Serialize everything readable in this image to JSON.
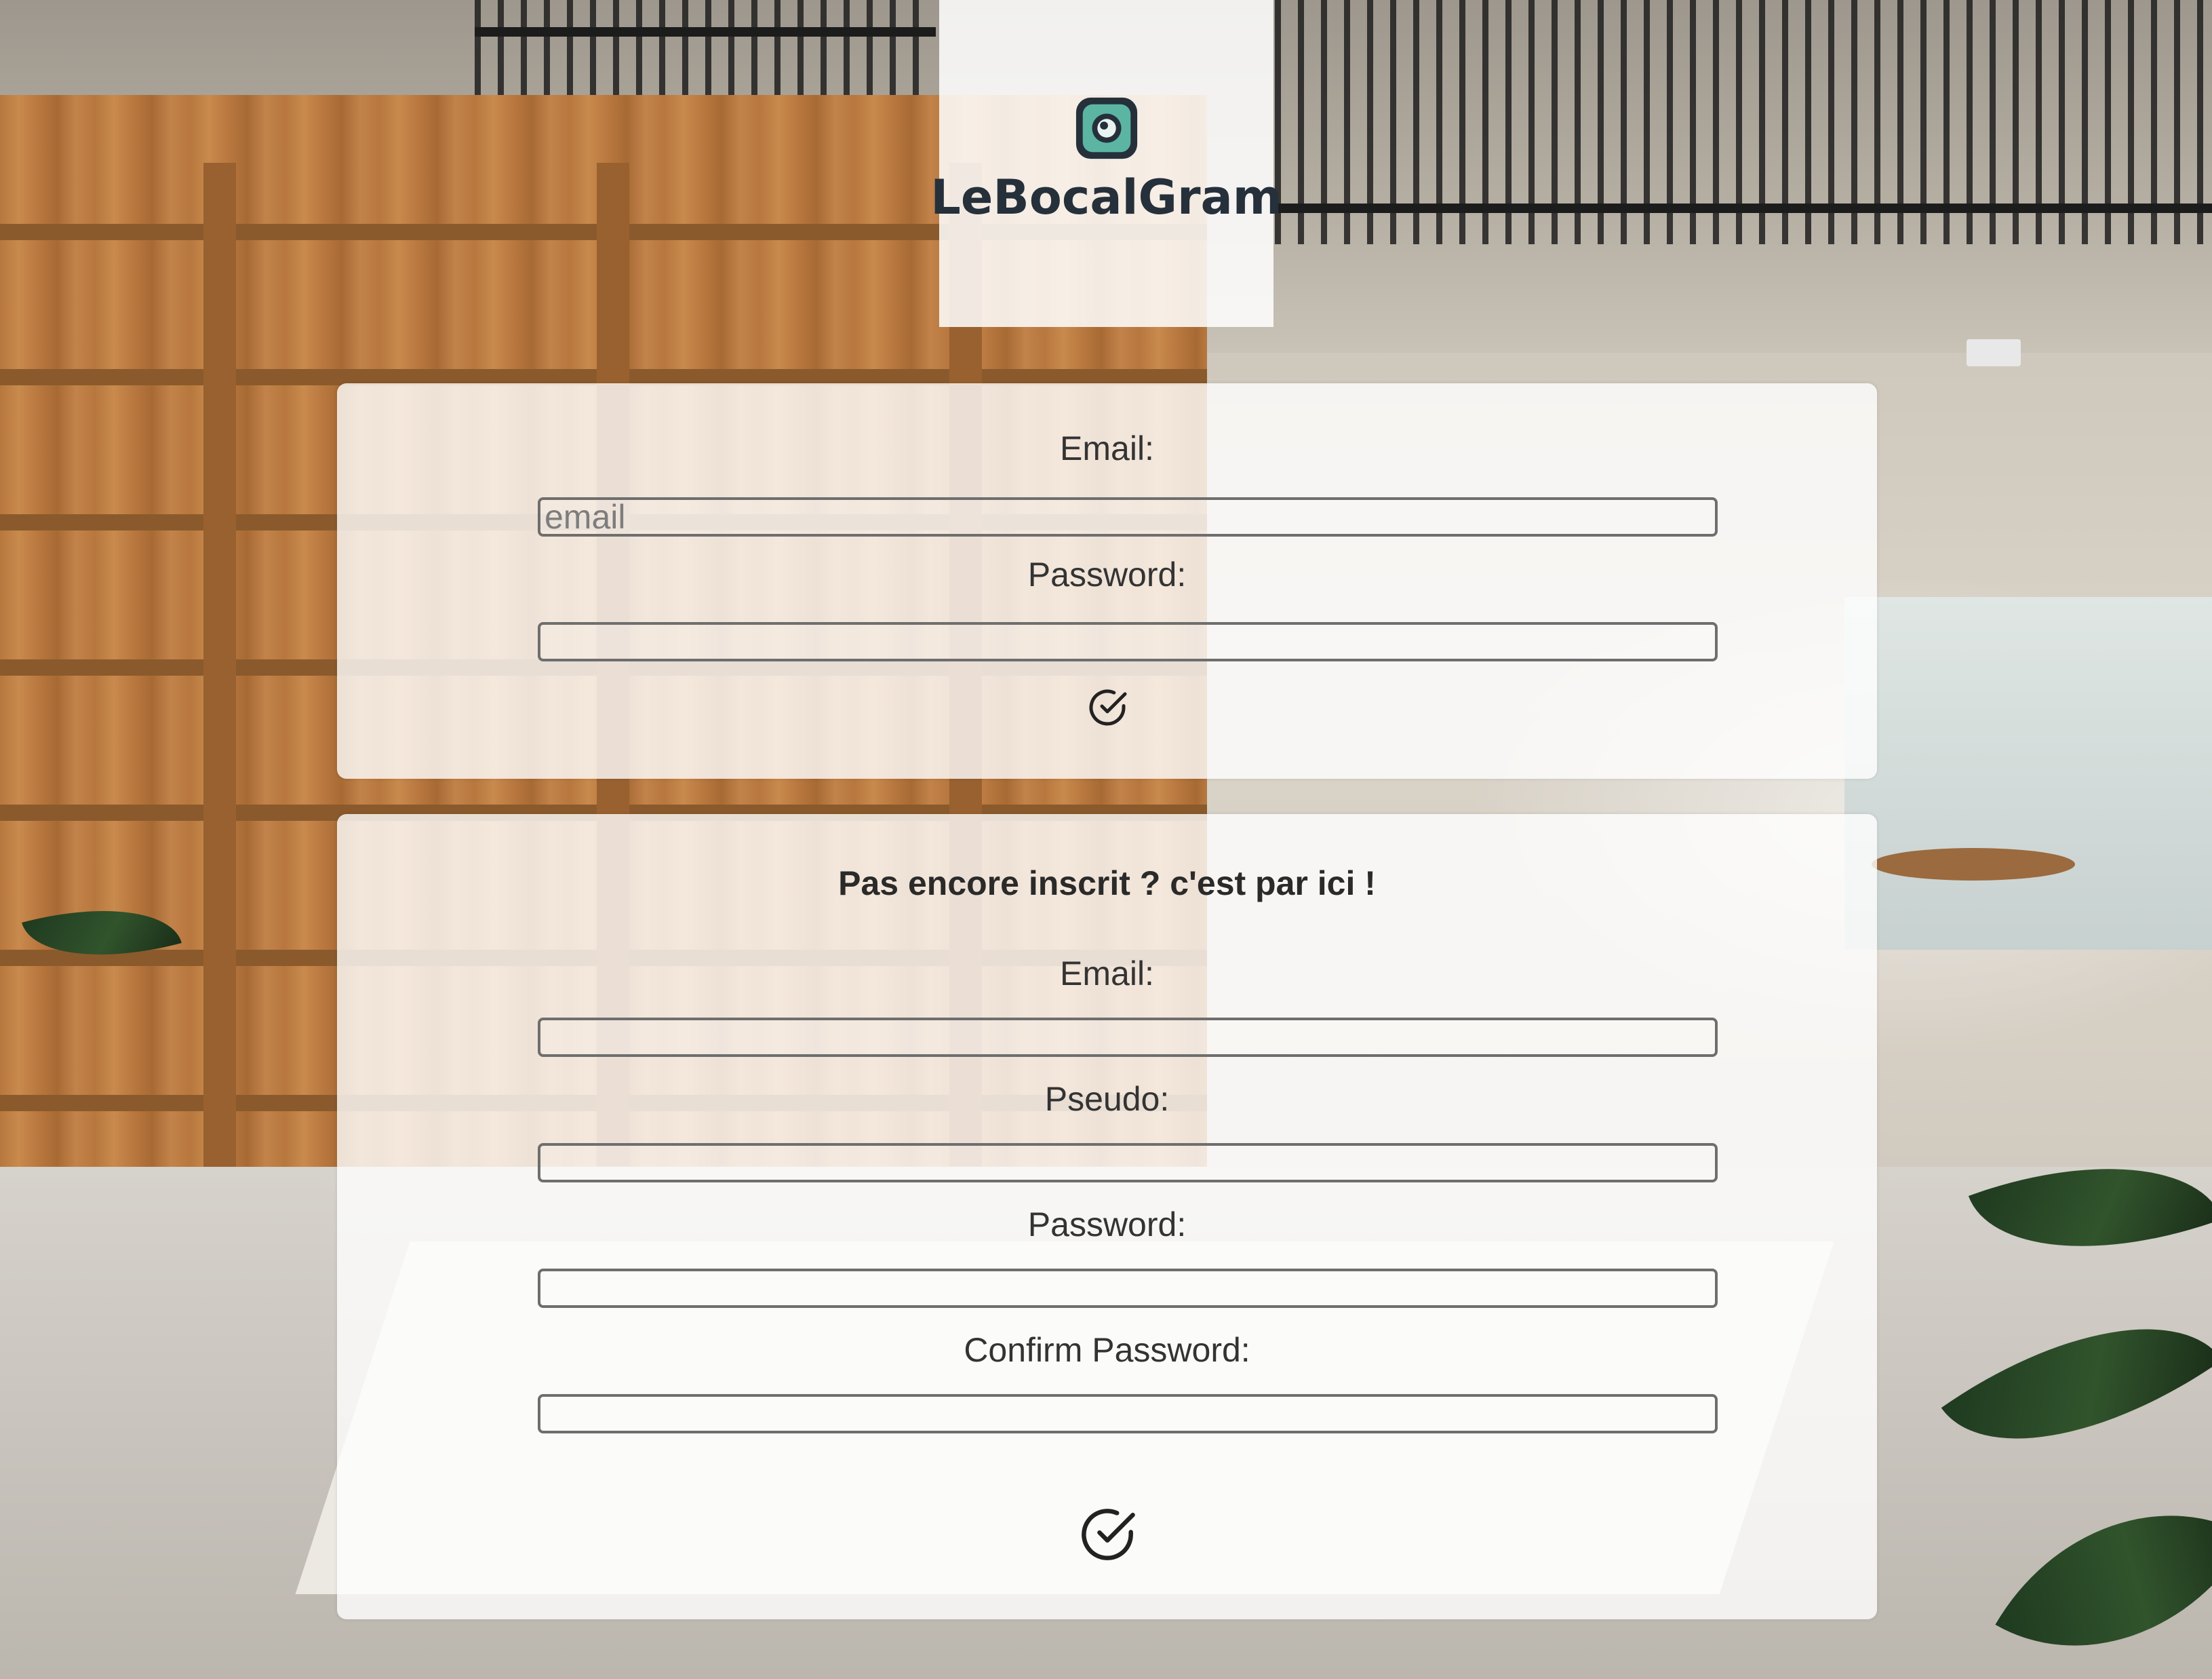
{
  "app": {
    "name": "LeBocalGram"
  },
  "login": {
    "email_label": "Email:",
    "email_placeholder": "email",
    "email_value": "",
    "password_label": "Password:",
    "password_value": "",
    "submit_icon": "check-circle-icon"
  },
  "signup": {
    "heading": "Pas encore inscrit ? c'est par ici !",
    "email_label": "Email:",
    "email_value": "",
    "pseudo_label": "Pseudo:",
    "pseudo_value": "",
    "password_label": "Password:",
    "password_value": "",
    "confirm_label": "Confirm Password:",
    "confirm_value": "",
    "submit_icon": "check-circle-icon"
  },
  "colors": {
    "logo_teal": "#5bb5a2",
    "logo_dark": "#25303b",
    "panel_bg": "rgba(255,255,255,0.80)",
    "field_border": "#6e6e6e"
  }
}
